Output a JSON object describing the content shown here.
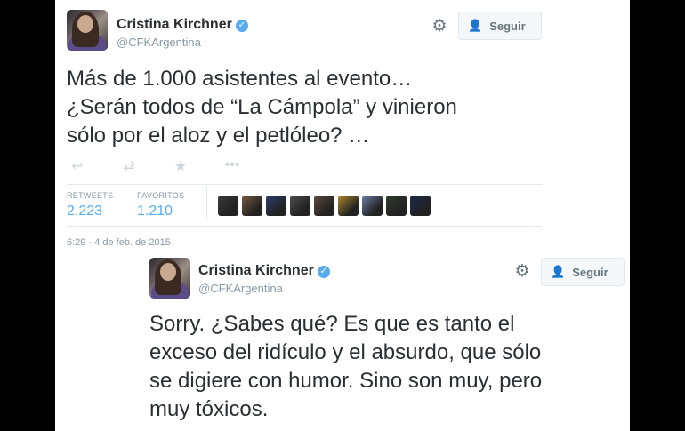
{
  "tweet1": {
    "author": "Cristina Kirchner",
    "handle": "@CFKArgentina",
    "follow_label": "Seguir",
    "line1": "Más de 1.000 asistentes al evento…",
    "line2": "¿Serán todos de “La Cámpola” y vinieron",
    "line3": "sólo por el aloz y el petlóleo? …",
    "retweets_label": "RETWEETS",
    "retweets_count": "2.223",
    "favorites_label": "FAVORITOS",
    "favorites_count": "1.210",
    "timestamp": "6:29 - 4 de feb. de 2015",
    "favoriters": [
      {
        "icon": "avatar-thumb",
        "color": "#3a3a3a"
      },
      {
        "icon": "avatar-thumb",
        "color": "#7a5a3e"
      },
      {
        "icon": "avatar-thumb",
        "color": "#2b3e6b"
      },
      {
        "icon": "avatar-thumb",
        "color": "#4d4d4d"
      },
      {
        "icon": "avatar-thumb",
        "color": "#5e4a3f"
      },
      {
        "icon": "avatar-thumb",
        "color": "#b08a2c"
      },
      {
        "icon": "avatar-thumb",
        "color": "#6b7fa8"
      },
      {
        "icon": "avatar-thumb",
        "color": "#2e3b2c"
      },
      {
        "icon": "avatar-thumb",
        "color": "#1a2a4a"
      }
    ]
  },
  "tweet2": {
    "author": "Cristina Kirchner",
    "handle": "@CFKArgentina",
    "follow_label": "Seguir",
    "line1": "Sorry. ¿Sabes qué? Es que es tanto el",
    "line2": "exceso del ridículo y el absurdo, que sólo",
    "line3": "se digiere con humor. Sino son muy, pero",
    "line4": "muy tóxicos."
  },
  "colors": {
    "accent": "#55acee",
    "text": "#292f33",
    "muted": "#8899a6"
  }
}
